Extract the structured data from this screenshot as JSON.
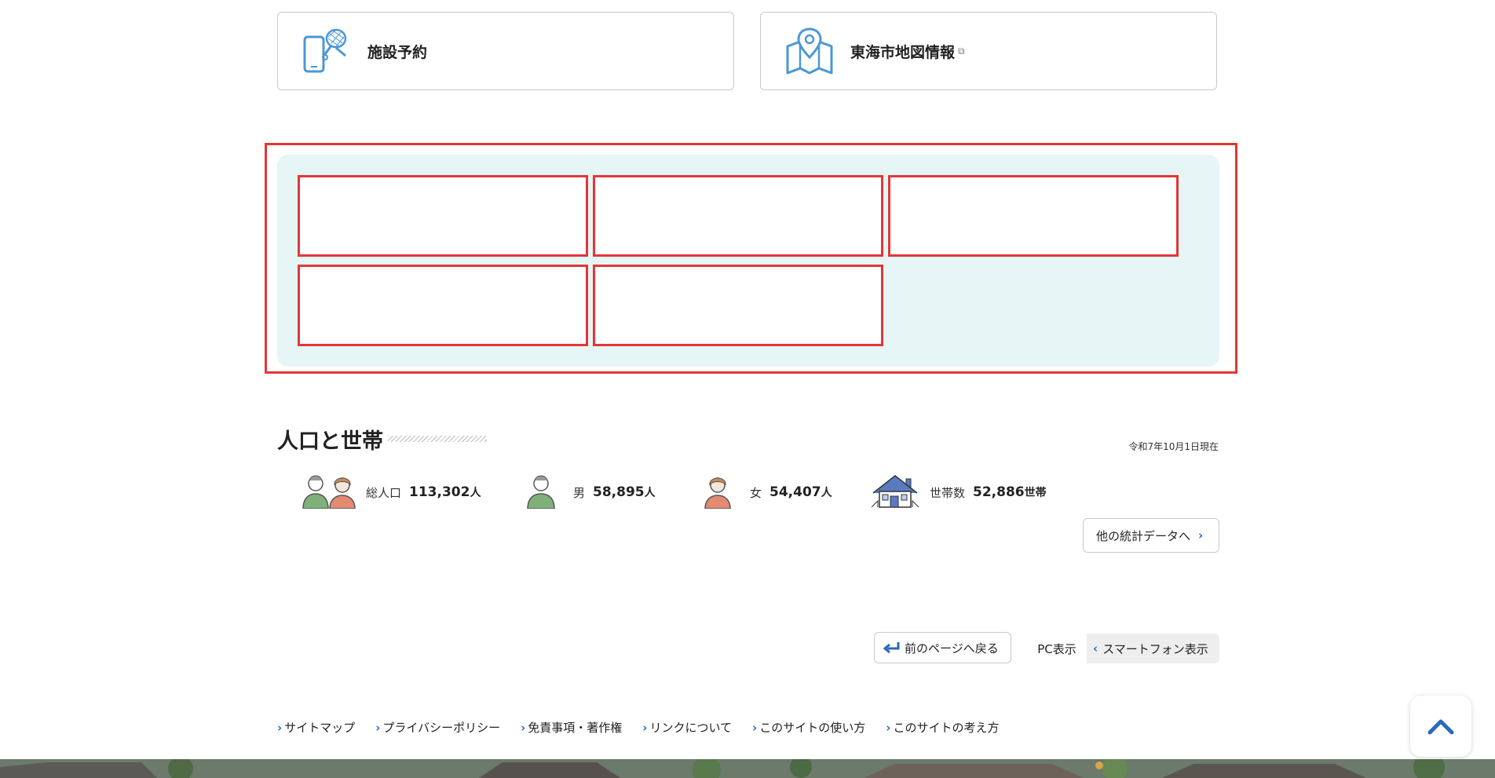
{
  "quick_links": [
    {
      "label": "施設予約",
      "icon": "tennis-racket-phone-icon"
    },
    {
      "label": "東海市地図情報",
      "icon": "map-pin-icon",
      "external": true
    }
  ],
  "population": {
    "title": "人口と世帯",
    "as_of": "令和7年10月1日現在",
    "stats": [
      {
        "label": "総人口",
        "value": "113,302",
        "unit": "人",
        "icon": "family-icon"
      },
      {
        "label": "男",
        "value": "58,895",
        "unit": "人",
        "icon": "man-icon"
      },
      {
        "label": "女",
        "value": "54,407",
        "unit": "人",
        "icon": "woman-icon"
      },
      {
        "label": "世帯数",
        "value": "52,886",
        "unit": "世帯",
        "icon": "house-icon"
      }
    ],
    "more_label": "他の統計データへ"
  },
  "nav": {
    "back_label": "前のページへ戻る",
    "pc_label": "PC表示",
    "sp_label": "スマートフォン表示"
  },
  "footer_links": [
    "サイトマップ",
    "プライバシーポリシー",
    "免責事項・著作権",
    "リンクについて",
    "このサイトの使い方",
    "このサイトの考え方"
  ],
  "colors": {
    "accent": "#2a6ab8",
    "banner_bg": "#e6f6f6",
    "highlight": "#e53636",
    "icon_blue": "#4b97d6"
  }
}
